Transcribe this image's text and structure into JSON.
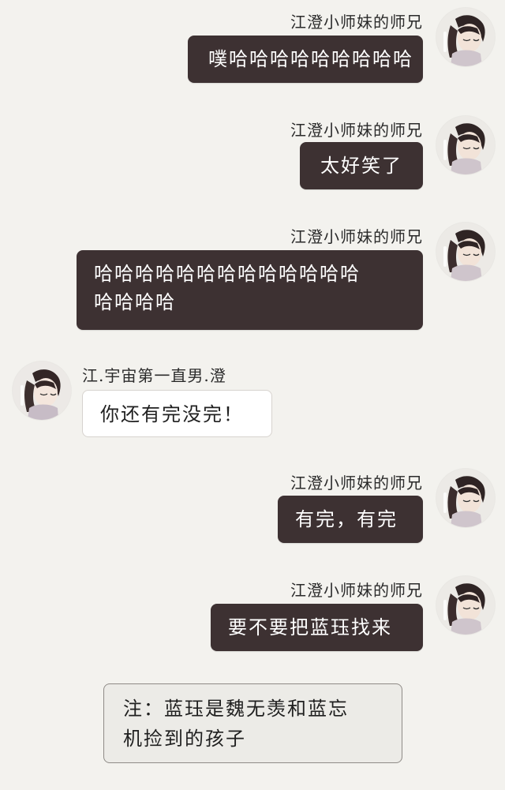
{
  "messages": [
    {
      "sender": "江澄小师妹的师兄",
      "text": "噗哈哈哈哈哈哈哈哈哈"
    },
    {
      "sender": "江澄小师妹的师兄",
      "text": "太好笑了"
    },
    {
      "sender": "江澄小师妹的师兄",
      "line1": "哈哈哈哈哈哈哈哈哈哈哈哈哈",
      "line2": "哈哈哈哈"
    },
    {
      "sender": "江.宇宙第一直男.澄",
      "text": "你还有完没完！"
    },
    {
      "sender": "江澄小师妹的师兄",
      "text": "有完，有完"
    },
    {
      "sender": "江澄小师妹的师兄",
      "text": "要不要把蓝珏找来"
    }
  ],
  "note": {
    "line1": "注：蓝珏是魏无羡和蓝忘",
    "line2": "机捡到的孩子"
  },
  "colors": {
    "background": "#f3f2ee",
    "dark_bubble": "#3d3132",
    "light_bubble": "#ffffff",
    "note_bg": "#ecebe7"
  }
}
